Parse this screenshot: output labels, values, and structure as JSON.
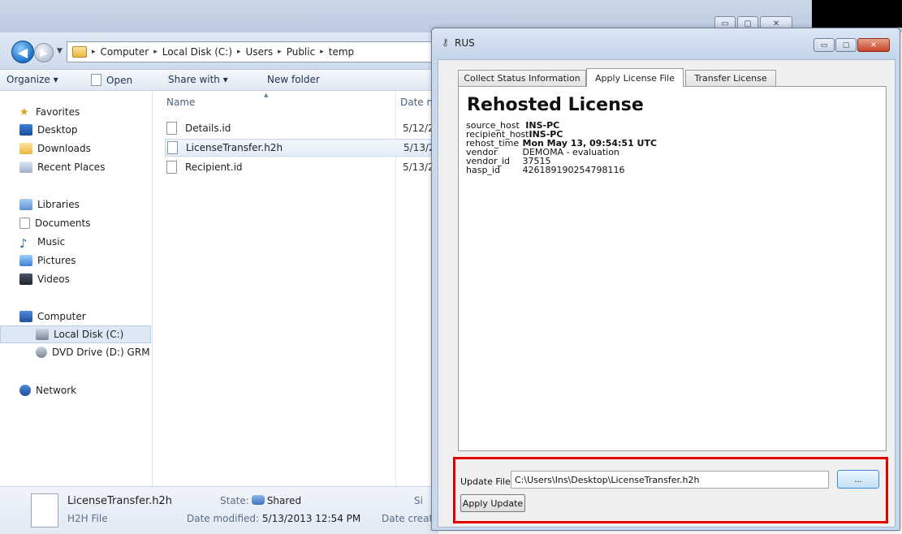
{
  "explorer": {
    "window_controls": {
      "minimize": "▭",
      "maximize": "▢",
      "close": "✕"
    },
    "nav": {
      "back": "◀",
      "forward": "▶",
      "dropdown": "▼"
    },
    "breadcrumb": [
      {
        "label": "Computer"
      },
      {
        "label": "Local Disk (C:)"
      },
      {
        "label": "Users"
      },
      {
        "label": "Public"
      },
      {
        "label": "temp"
      }
    ],
    "breadcrumb_sep": "▸",
    "toolbar": {
      "organize": "Organize ▾",
      "open": "Open",
      "share_with": "Share with ▾",
      "new_folder": "New folder"
    },
    "sidebar": {
      "favorites": "Favorites",
      "desktop": "Desktop",
      "downloads": "Downloads",
      "recent_places": "Recent Places",
      "libraries": "Libraries",
      "documents": "Documents",
      "music": "Music",
      "pictures": "Pictures",
      "videos": "Videos",
      "computer": "Computer",
      "local_disk": "Local Disk (C:)",
      "dvd_drive": "DVD Drive (D:) GRM",
      "network": "Network"
    },
    "file_list": {
      "col_name": "Name",
      "col_date": "Date m",
      "sort_glyph": "▲",
      "files": [
        {
          "name": "Details.id",
          "date": "5/12/2"
        },
        {
          "name": "LicenseTransfer.h2h",
          "date": "5/13/2"
        },
        {
          "name": "Recipient.id",
          "date": "5/13/2"
        }
      ]
    },
    "status": {
      "file_name": "LicenseTransfer.h2h",
      "file_type": "H2H File",
      "state_label": "State:",
      "state_value": "Shared",
      "modified_label": "Date modified:",
      "modified_value": "5/13/2013 12:54 PM",
      "created_label": "Date creat",
      "size_label": "Si"
    }
  },
  "rus": {
    "title": "RUS",
    "window_controls": {
      "minimize": "▭",
      "maximize": "▢",
      "close": "✕"
    },
    "tabs": [
      {
        "label": "Collect Status Information"
      },
      {
        "label": "Apply License File"
      },
      {
        "label": "Transfer License"
      }
    ],
    "active_tab": "Apply License File",
    "license": {
      "heading": "Rehosted License",
      "fields": [
        {
          "key": "source_host",
          "value": "INS-PC"
        },
        {
          "key": "recipient_host",
          "value": "INS-PC"
        },
        {
          "key": "rehost_time",
          "value": "Mon May 13, 09:54:51 UTC"
        },
        {
          "key": "vendor",
          "value": "DEMOMA - evaluation"
        },
        {
          "key": "vendor_id",
          "value": "37515"
        },
        {
          "key": "hasp_id",
          "value": "426189190254798116"
        }
      ]
    },
    "update": {
      "label": "Update File",
      "path": "C:\\Users\\Ins\\Desktop\\LicenseTransfer.h2h",
      "browse": "...",
      "apply": "Apply Update"
    },
    "highlight_color": "#e00000"
  }
}
